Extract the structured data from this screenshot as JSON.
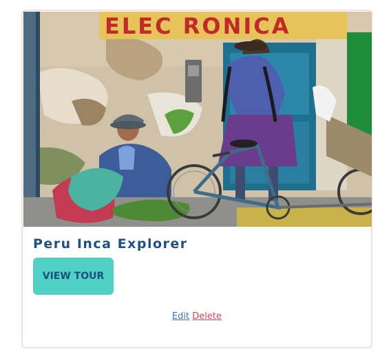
{
  "card": {
    "image_alt": "Market vendor in Peru",
    "sign_text": "ELEC RONICA",
    "title": "Peru Inca Explorer",
    "view_button_label": "VIEW TOUR",
    "edit_label": "Edit",
    "delete_label": "Delete"
  },
  "colors": {
    "title": "#1f4f86",
    "button_bg": "#4fd1c5",
    "button_text": "#1c4f7c",
    "edit_link": "#3b77c2",
    "delete_link": "#e0445a",
    "card_border": "#f8dde2"
  }
}
